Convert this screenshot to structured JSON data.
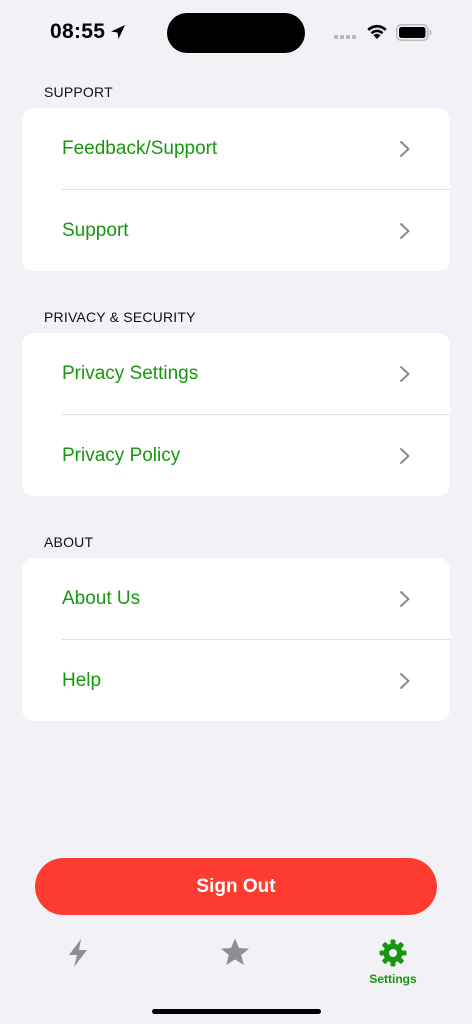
{
  "status_bar": {
    "time": "08:55"
  },
  "sections": [
    {
      "header": "SUPPORT",
      "items": [
        {
          "label": "Feedback/Support",
          "icon": "chevron-right-icon"
        },
        {
          "label": "Support",
          "icon": "chevron-right-icon"
        }
      ]
    },
    {
      "header": "PRIVACY & SECURITY",
      "items": [
        {
          "label": "Privacy Settings",
          "icon": "chevron-right-icon"
        },
        {
          "label": "Privacy Policy",
          "icon": "chevron-right-icon"
        }
      ]
    },
    {
      "header": "ABOUT",
      "items": [
        {
          "label": "About Us",
          "icon": "chevron-right-icon"
        },
        {
          "label": "Help",
          "icon": "chevron-right-icon"
        }
      ]
    }
  ],
  "sign_out": {
    "label": "Sign Out"
  },
  "tabbar": {
    "tabs": [
      {
        "icon": "bolt-icon",
        "label": "",
        "selected": false
      },
      {
        "icon": "star-icon",
        "label": "",
        "selected": false
      },
      {
        "icon": "gear-icon",
        "label": "Settings",
        "selected": true
      }
    ]
  },
  "colors": {
    "accent": "#16970f",
    "destructive": "#fe3b30",
    "background": "#f2f1f6",
    "card": "#ffffff",
    "inactive_icon": "#8e8e93"
  }
}
